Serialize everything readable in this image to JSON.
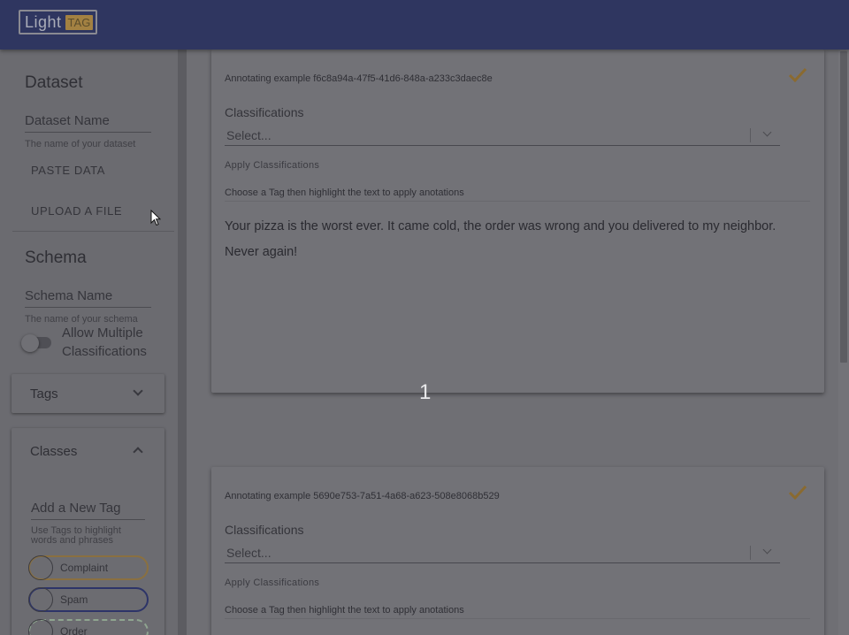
{
  "app": {
    "logo_light": "Light",
    "logo_tag": "TAG"
  },
  "sidebar": {
    "dataset": {
      "title": "Dataset",
      "name_label": "Dataset Name",
      "name_helper": "The name of your dataset",
      "paste_button": "PASTE DATA",
      "upload_button": "UPLOAD A FILE"
    },
    "schema": {
      "title": "Schema",
      "name_label": "Schema Name",
      "name_helper": "The name of your schema",
      "toggle_label": "Allow Multiple Classifications",
      "toggle_on": false
    },
    "tags_panel": {
      "title": "Tags",
      "expanded": false
    },
    "classes_panel": {
      "title": "Classes",
      "expanded": true,
      "add_label": "Add a New Tag",
      "add_helper": "Use Tags to highlight words and phrases",
      "chips": [
        {
          "label": "Complaint",
          "color": "#8a7040"
        },
        {
          "label": "Spam",
          "color": "#2d3468"
        },
        {
          "label": "Order",
          "color": "#8fa590"
        }
      ]
    }
  },
  "examples": [
    {
      "header": "Annotating example f6c8a94a-47f5-41d6-848a-a233c3daec8e",
      "classifications_label": "Classifications",
      "select_placeholder": "Select...",
      "apply_label": "Apply Classifications",
      "tag_instruction": "Choose a Tag then highlight the text to apply anotations",
      "text": "Your pizza is the worst ever. It came cold, the order was wrong and you delivered to my neighbor. Never again!"
    },
    {
      "header": "Annotating example 5690e753-7a51-4a68-a623-508e8068b529",
      "classifications_label": "Classifications",
      "select_placeholder": "Select...",
      "apply_label": "Apply Classifications",
      "tag_instruction": "Choose a Tag then highlight the text to apply anotations",
      "text": ""
    }
  ],
  "overlay": {
    "index_label": "1"
  },
  "colors": {
    "appbar": "#2f3660",
    "check": "#8a6a30",
    "tag_accent": "#a38142"
  }
}
